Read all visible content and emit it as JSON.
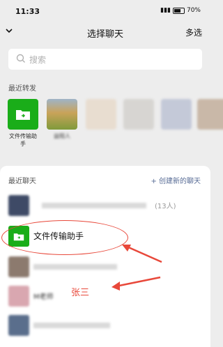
{
  "status": {
    "time": "11:33",
    "battery": "70%"
  },
  "header": {
    "title": "选择聊天",
    "multi_label": "多选"
  },
  "search": {
    "placeholder": "搜索"
  },
  "recent_forward": {
    "heading": "最近转发",
    "items": [
      {
        "label": "文件传输助手"
      },
      {
        "label": "益阳人"
      },
      {
        "label": ""
      },
      {
        "label": ""
      },
      {
        "label": ""
      },
      {
        "label": ""
      }
    ]
  },
  "recent_chat": {
    "heading": "最近聊天",
    "new_chat_label": "+ 创建新的聊天",
    "rows": [
      {
        "name": "(13人)"
      },
      {
        "name": "文件传输助手"
      },
      {
        "name": ""
      },
      {
        "name": "M老师"
      },
      {
        "name": ""
      }
    ]
  },
  "annotation": {
    "label": "张三"
  },
  "colors": {
    "wechat_green": "#1aad19",
    "link_blue": "#576b95",
    "annotation_red": "#e8483a"
  }
}
